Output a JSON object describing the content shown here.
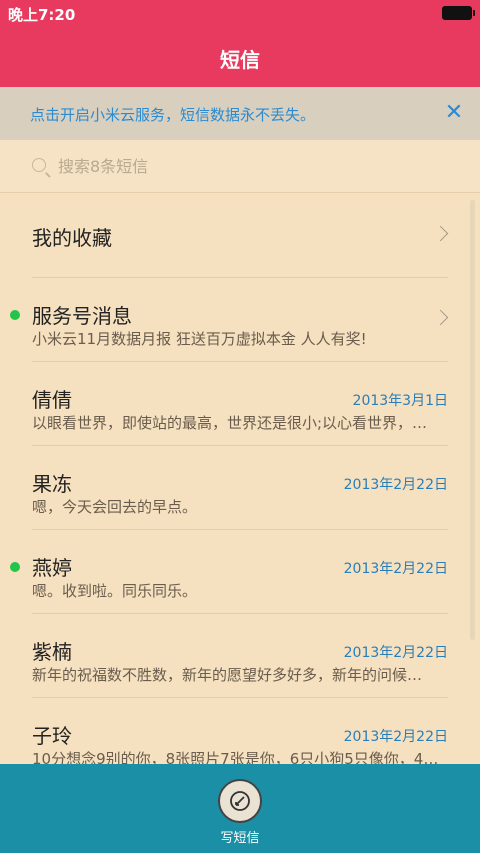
{
  "status": {
    "time": "晚上7:20"
  },
  "header": {
    "title": "短信"
  },
  "banner": {
    "text": "点击开启小米云服务，短信数据永不丢失。"
  },
  "search": {
    "placeholder": "搜索8条短信"
  },
  "list": [
    {
      "name": "我的收藏",
      "snippet": "",
      "date": "",
      "chevron": true,
      "unread": false
    },
    {
      "name": "服务号消息",
      "snippet": "小米云11月数据月报 狂送百万虚拟本金 人人有奖!",
      "date": "",
      "chevron": true,
      "unread": true
    },
    {
      "name": "倩倩",
      "snippet": "以眼看世界，即使站的最高，世界还是很小;以心看世界，…",
      "date": "2013年3月1日",
      "chevron": false,
      "unread": false
    },
    {
      "name": "果冻",
      "snippet": "嗯，今天会回去的早点。",
      "date": "2013年2月22日",
      "chevron": false,
      "unread": false
    },
    {
      "name": "燕婷",
      "snippet": "嗯。收到啦。同乐同乐。",
      "date": "2013年2月22日",
      "chevron": false,
      "unread": true
    },
    {
      "name": "紫楠",
      "snippet": "新年的祝福数不胜数，新年的愿望好多好多，新年的问候…",
      "date": "2013年2月22日",
      "chevron": false,
      "unread": false
    },
    {
      "name": "子玲",
      "snippet": "10分想念9别的你，8张照片7张是你，6只小狗5只像你，4…",
      "date": "2013年2月22日",
      "chevron": false,
      "unread": false
    }
  ],
  "footer": {
    "compose_label": "写短信"
  },
  "colors": {
    "header": "#e8395e",
    "footer": "#1b8fa6",
    "accent": "#2a8bd2",
    "unread_dot": "#22c44a"
  }
}
